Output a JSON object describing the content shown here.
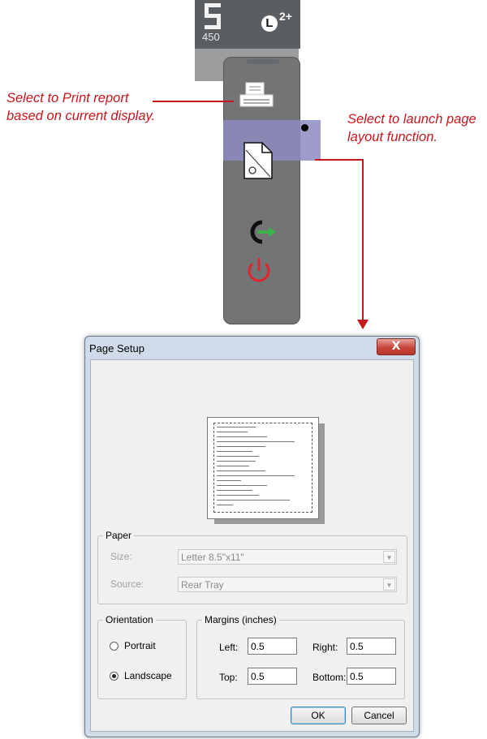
{
  "device": {
    "brand_icon": "s-brand-logo-icon",
    "model": "450",
    "lock_indicator": "L",
    "lock_superscript": "2+"
  },
  "panel": {
    "items": [
      {
        "icon": "printer-icon"
      },
      {
        "icon": "page-layout-icon"
      },
      {
        "icon": "export-icon"
      },
      {
        "icon": "power-icon"
      }
    ]
  },
  "annotations": {
    "print": [
      "Select to Print report",
      "based on current display."
    ],
    "layout": [
      "Select to launch page",
      "layout function."
    ]
  },
  "dialog": {
    "title": "Page Setup",
    "close_label": "X",
    "paper": {
      "label": "Paper",
      "size_label": "Size:",
      "size_value": "Letter 8.5\"x11\"",
      "source_label": "Source:",
      "source_value": "Rear Tray"
    },
    "orientation": {
      "label": "Orientation",
      "portrait": "Portrait",
      "landscape": "Landscape",
      "selected": "Landscape"
    },
    "margins": {
      "label": "Margins (inches)",
      "left_label": "Left:",
      "left_value": "0.5",
      "right_label": "Right:",
      "right_value": "0.5",
      "top_label": "Top:",
      "top_value": "0.5",
      "bottom_label": "Bottom:",
      "bottom_value": "0.5"
    },
    "ok_label": "OK",
    "cancel_label": "Cancel"
  },
  "colors": {
    "annotation": "#c8161d",
    "panel": "#727476",
    "highlight": "#8d8cc1",
    "power": "#e0262c",
    "export_arrow": "#3bb34a"
  }
}
